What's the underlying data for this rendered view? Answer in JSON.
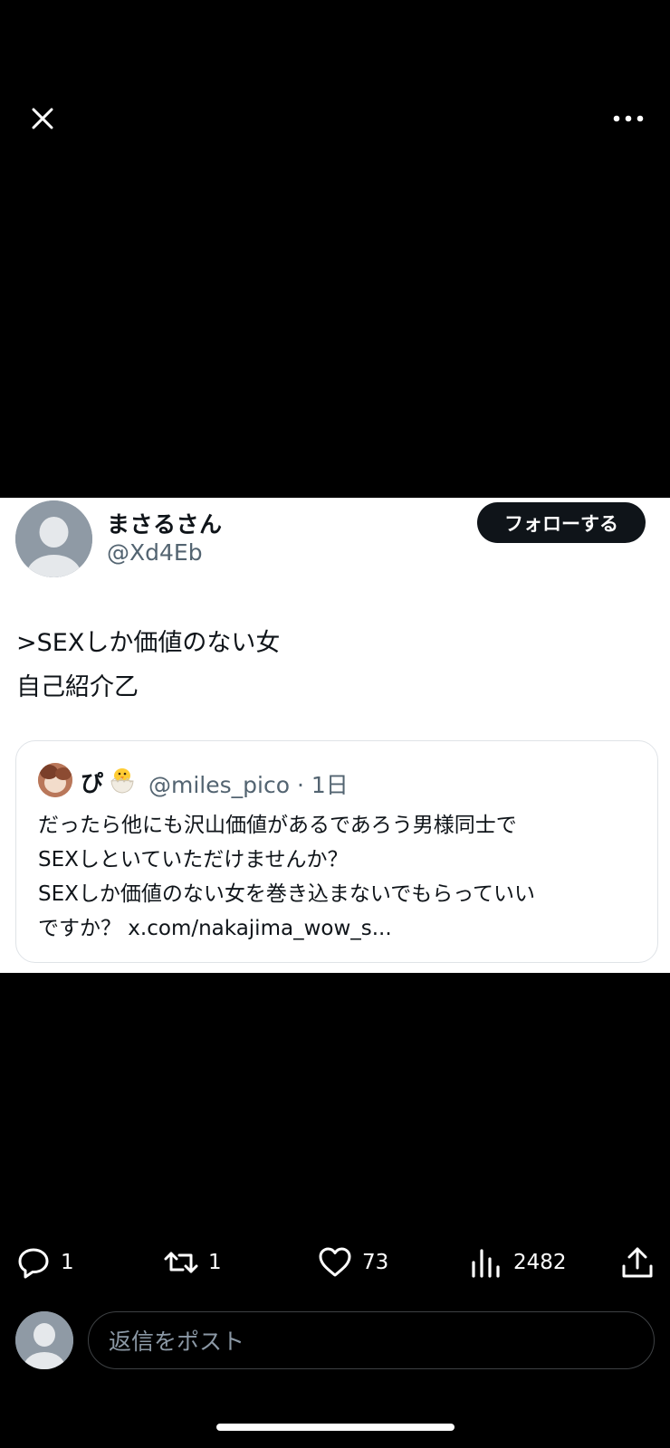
{
  "tweet": {
    "display_name": "まさるさん",
    "handle": "@Xd4Eb",
    "follow_label": "フォローする",
    "text_lines": [
      ">SEXしか価値のない女",
      "自己紹介乙"
    ]
  },
  "quote": {
    "name": "ぴ",
    "emoji": "hatching-chick",
    "handle": "@miles_pico",
    "time": "1日",
    "text_lines": [
      "だったら他にも沢山価値があるであろう男様同士で",
      "SEXしといていただけませんか？",
      "SEXしか価値のない女を巻き込まないでもらっていい",
      "ですか？ x.com/nakajima_wow_s..."
    ]
  },
  "actions": {
    "replies": "1",
    "reposts": "1",
    "likes": "73",
    "views": "2482"
  },
  "reply_box": {
    "placeholder": "返信をポスト"
  },
  "icons": [
    "close-icon",
    "more-icon",
    "reply-icon",
    "repost-icon",
    "like-icon",
    "views-icon",
    "share-icon"
  ],
  "colors": {
    "background": "#000000",
    "card": "#ffffff",
    "text_primary": "#0f1419",
    "text_secondary": "#536471",
    "follow_button": "#0f1419"
  }
}
